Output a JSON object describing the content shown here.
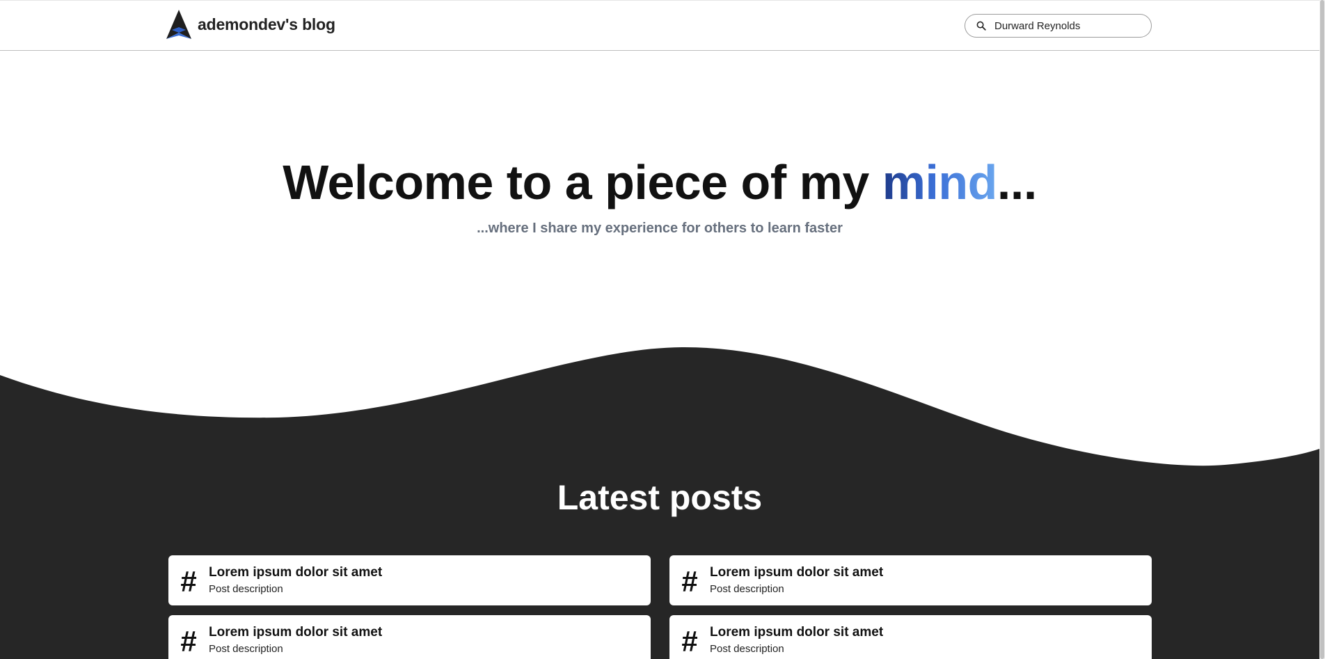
{
  "header": {
    "brand_name": "ademondev's blog",
    "search": {
      "value": "Durward Reynolds",
      "icon": "search-icon"
    }
  },
  "hero": {
    "title_prefix": "Welcome to a piece of my ",
    "title_accent": "mind",
    "title_suffix": "...",
    "subtitle": "...where I share my experience for others to learn faster"
  },
  "latest": {
    "title": "Latest posts",
    "posts": [
      {
        "icon": "#",
        "title": "Lorem ipsum dolor sit amet",
        "description": "Post description"
      },
      {
        "icon": "#",
        "title": "Lorem ipsum dolor sit amet",
        "description": "Post description"
      },
      {
        "icon": "#",
        "title": "Lorem ipsum dolor sit amet",
        "description": "Post description"
      },
      {
        "icon": "#",
        "title": "Lorem ipsum dolor sit amet",
        "description": "Post description"
      }
    ]
  },
  "colors": {
    "dark_section": "#262626",
    "accent_start": "#1e3a8a",
    "accent_end": "#6aa6ee",
    "subtitle": "#666f7d"
  }
}
